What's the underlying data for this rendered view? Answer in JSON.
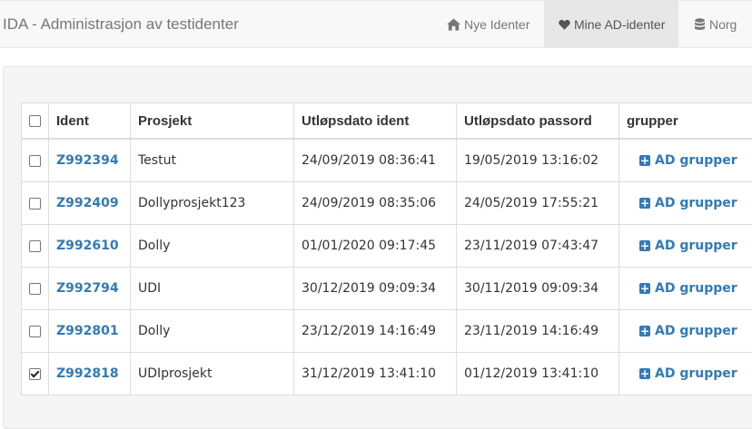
{
  "navbar": {
    "brand": "IDA - Administrasjon av testidenter",
    "items": [
      {
        "label": "Nye Identer",
        "icon": "home-icon"
      },
      {
        "label": "Mine AD-identer",
        "icon": "heart-icon",
        "active": true
      },
      {
        "label": "Norg",
        "icon": "database-icon"
      }
    ]
  },
  "table": {
    "headers": [
      "Ident",
      "Prosjekt",
      "Utløpsdato ident",
      "Utløpsdato passord",
      "grupper"
    ],
    "rows": [
      {
        "checked": false,
        "ident": "Z992394",
        "prosjekt": "Testut",
        "ident_expiry": "24/09/2019 08:36:41",
        "password_expiry": "19/05/2019 13:16:02",
        "groups_label": "AD grupper"
      },
      {
        "checked": false,
        "ident": "Z992409",
        "prosjekt": "Dollyprosjekt123",
        "ident_expiry": "24/09/2019 08:35:06",
        "password_expiry": "24/05/2019 17:55:21",
        "groups_label": "AD grupper"
      },
      {
        "checked": false,
        "ident": "Z992610",
        "prosjekt": "Dolly",
        "ident_expiry": "01/01/2020 09:17:45",
        "password_expiry": "23/11/2019 07:43:47",
        "groups_label": "AD grupper"
      },
      {
        "checked": false,
        "ident": "Z992794",
        "prosjekt": "UDI",
        "ident_expiry": "30/12/2019 09:09:34",
        "password_expiry": "30/11/2019 09:09:34",
        "groups_label": "AD grupper"
      },
      {
        "checked": false,
        "ident": "Z992801",
        "prosjekt": "Dolly",
        "ident_expiry": "23/12/2019 14:16:49",
        "password_expiry": "23/11/2019 14:16:49",
        "groups_label": "AD grupper"
      },
      {
        "checked": true,
        "ident": "Z992818",
        "prosjekt": "UDIprosjekt",
        "ident_expiry": "31/12/2019 13:41:10",
        "password_expiry": "01/12/2019 13:41:10",
        "groups_label": "AD grupper"
      }
    ]
  },
  "colors": {
    "link": "#337ab7",
    "navbar_bg": "#f8f8f8",
    "active_tab_bg": "#e7e7e7"
  }
}
